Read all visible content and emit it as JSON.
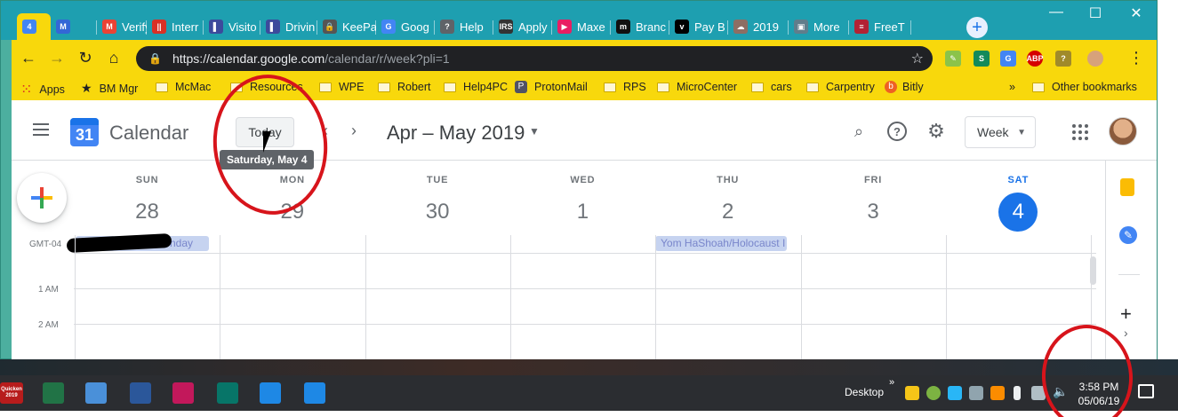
{
  "browser": {
    "tabs": [
      {
        "label": "",
        "icon": "calendar-icon",
        "color": "#4285f4",
        "glyph": "4"
      },
      {
        "label": "",
        "icon": "m-blue-icon",
        "color": "#3367d6",
        "glyph": "M"
      },
      {
        "label": "Verify",
        "icon": "gmail-icon",
        "color": "#ea4335",
        "glyph": "M"
      },
      {
        "label": "Interr",
        "icon": "pause-bars-icon",
        "color": "#d93025",
        "glyph": "||"
      },
      {
        "label": "Visito",
        "icon": "bookmark-flag-icon",
        "color": "#3c4a9c",
        "glyph": "▌"
      },
      {
        "label": "Drivin",
        "icon": "bookmark-flag-icon",
        "color": "#3c4a9c",
        "glyph": "▌"
      },
      {
        "label": "KeePa",
        "icon": "keepass-lock-icon",
        "color": "#555555",
        "glyph": "🔒"
      },
      {
        "label": "Goog",
        "icon": "google-cloud-icon",
        "color": "#4285f4",
        "glyph": "G"
      },
      {
        "label": "Help",
        "icon": "help-page-icon",
        "color": "#5f6368",
        "glyph": "?"
      },
      {
        "label": "Apply",
        "icon": "irs-icon",
        "color": "#333333",
        "glyph": "IRS"
      },
      {
        "label": "Maxe",
        "icon": "play-circle-icon",
        "color": "#e91e63",
        "glyph": "▶"
      },
      {
        "label": "Branc",
        "icon": "m-black-icon",
        "color": "#111111",
        "glyph": "m"
      },
      {
        "label": "Pay B",
        "icon": "verizon-icon",
        "color": "#000000",
        "glyph": "v"
      },
      {
        "label": "2019",
        "icon": "cloud-icon",
        "color": "#8d6e63",
        "glyph": "☁"
      },
      {
        "label": "More",
        "icon": "page-icon",
        "color": "#607d8b",
        "glyph": "▣"
      },
      {
        "label": "FreeT",
        "icon": "us-flag-icon",
        "color": "#b22234",
        "glyph": "≡"
      }
    ],
    "new_tab": "+",
    "window_controls": {
      "minimize": "—",
      "maximize": "☐",
      "close": "✕"
    },
    "url_host": "https://calendar.google.com",
    "url_path": "/calendar/r/week?pli=1",
    "bookmarks": [
      {
        "label": "Apps",
        "icon": "apps-grid-icon"
      },
      {
        "label": "BM Mgr",
        "icon": "star-icon"
      },
      {
        "label": "McMac",
        "icon": "folder-icon"
      },
      {
        "label": "Resources",
        "icon": "folder-icon"
      },
      {
        "label": "WPE",
        "icon": "folder-icon"
      },
      {
        "label": "Robert",
        "icon": "folder-icon"
      },
      {
        "label": "Help4PC",
        "icon": "folder-icon"
      },
      {
        "label": "ProtonMail",
        "icon": "protonmail-icon"
      },
      {
        "label": "RPS",
        "icon": "folder-icon"
      },
      {
        "label": "MicroCenter",
        "icon": "folder-icon"
      },
      {
        "label": "cars",
        "icon": "folder-icon"
      },
      {
        "label": "Carpentry",
        "icon": "folder-icon"
      },
      {
        "label": "Bitly",
        "icon": "bitly-icon"
      }
    ],
    "overflow": "»",
    "other_bookmarks": "Other bookmarks"
  },
  "calendar": {
    "app_title": "Calendar",
    "logo_number": "31",
    "today_button": "Today",
    "today_tooltip": "Saturday, May 4",
    "date_range": "Apr – May 2019",
    "view_select": "Week",
    "timezone": "GMT-04",
    "days": [
      {
        "dow": "SUN",
        "num": "28",
        "today": false
      },
      {
        "dow": "MON",
        "num": "29",
        "today": false
      },
      {
        "dow": "TUE",
        "num": "30",
        "today": false
      },
      {
        "dow": "WED",
        "num": "1",
        "today": false
      },
      {
        "dow": "THU",
        "num": "2",
        "today": false
      },
      {
        "dow": "FRI",
        "num": "3",
        "today": false
      },
      {
        "dow": "SAT",
        "num": "4",
        "today": true
      }
    ],
    "all_day_events": [
      {
        "label": "nday",
        "day": "SUN"
      },
      {
        "label": "Yom HaShoah/Holocaust I",
        "day": "THU"
      }
    ],
    "hours": [
      "1 AM",
      "2 AM"
    ],
    "accent": "#1a73e8"
  },
  "taskbar": {
    "pinned": [
      {
        "icon": "quicken-icon",
        "label": "Quicken 2019",
        "color": "#b71c1c"
      },
      {
        "icon": "excel-icon",
        "color": "#217346"
      },
      {
        "icon": "image-viewer-icon",
        "color": "#4a90d9"
      },
      {
        "icon": "word-icon",
        "color": "#2b579a"
      },
      {
        "icon": "feather-app-icon",
        "color": "#c2185b"
      },
      {
        "icon": "publisher-icon",
        "color": "#077568"
      },
      {
        "icon": "messenger-icon",
        "color": "#1e88e5"
      },
      {
        "icon": "cloud-upload-icon",
        "color": "#1e88e5"
      }
    ],
    "desktop_label": "Desktop",
    "desktop_chevron": "»",
    "time": "3:58 PM",
    "date": "05/06/19"
  }
}
